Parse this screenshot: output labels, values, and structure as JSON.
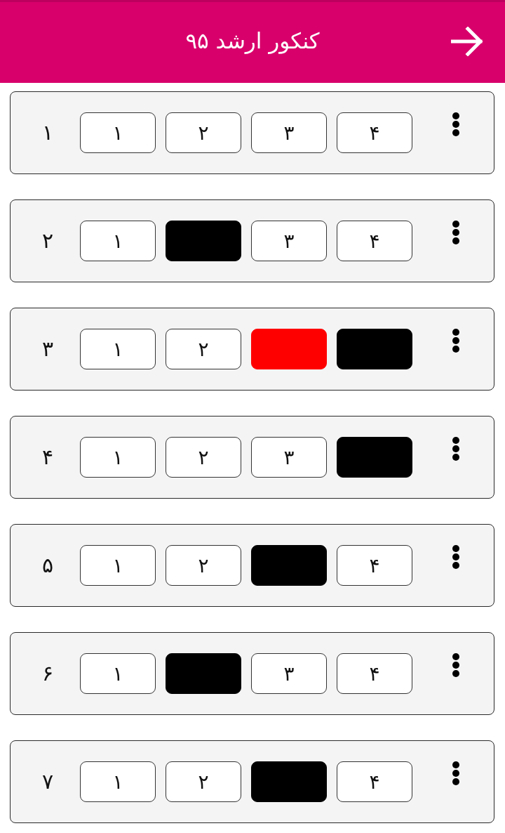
{
  "header": {
    "title": "کنکور ارشد ۹۵"
  },
  "questions": [
    {
      "number": "۱",
      "options": [
        {
          "label": "۴",
          "selected": false
        },
        {
          "label": "۳",
          "selected": false
        },
        {
          "label": "۲",
          "selected": false
        },
        {
          "label": "۱",
          "selected": false
        }
      ]
    },
    {
      "number": "۲",
      "options": [
        {
          "label": "۴",
          "selected": false
        },
        {
          "label": "۳",
          "selected": false
        },
        {
          "selected": true,
          "color": "#000000"
        },
        {
          "label": "۱",
          "selected": false
        }
      ]
    },
    {
      "number": "۳",
      "options": [
        {
          "selected": true,
          "color": "#000000"
        },
        {
          "selected": true,
          "color": "#ff0000"
        },
        {
          "label": "۲",
          "selected": false
        },
        {
          "label": "۱",
          "selected": false
        }
      ]
    },
    {
      "number": "۴",
      "options": [
        {
          "selected": true,
          "color": "#000000"
        },
        {
          "label": "۳",
          "selected": false
        },
        {
          "label": "۲",
          "selected": false
        },
        {
          "label": "۱",
          "selected": false
        }
      ]
    },
    {
      "number": "۵",
      "options": [
        {
          "label": "۴",
          "selected": false
        },
        {
          "selected": true,
          "color": "#000000"
        },
        {
          "label": "۲",
          "selected": false
        },
        {
          "label": "۱",
          "selected": false
        }
      ]
    },
    {
      "number": "۶",
      "options": [
        {
          "label": "۴",
          "selected": false
        },
        {
          "label": "۳",
          "selected": false
        },
        {
          "selected": true,
          "color": "#000000"
        },
        {
          "label": "۱",
          "selected": false
        }
      ]
    },
    {
      "number": "۷",
      "options": [
        {
          "label": "۴",
          "selected": false
        },
        {
          "selected": true,
          "color": "#000000"
        },
        {
          "label": "۲",
          "selected": false
        },
        {
          "label": "۱",
          "selected": false
        }
      ]
    }
  ]
}
